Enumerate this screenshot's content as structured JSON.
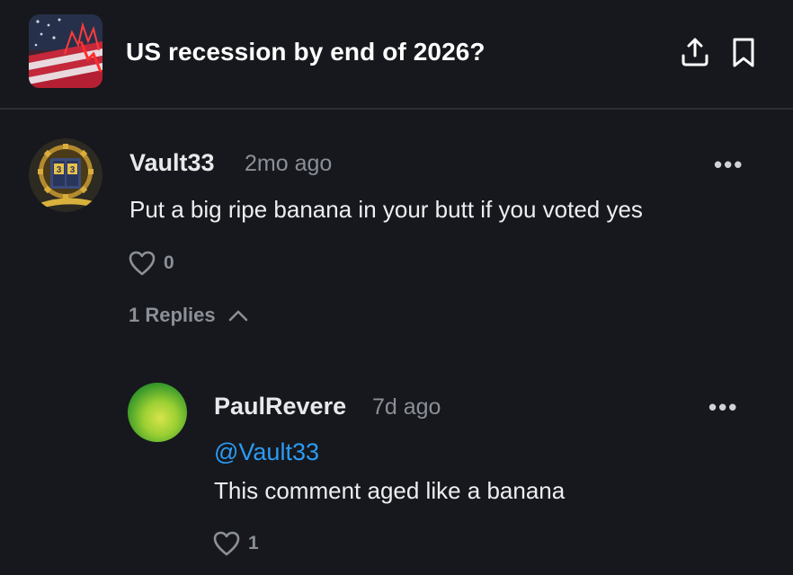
{
  "market": {
    "title": "US recession by end of 2026?"
  },
  "header_icons": {
    "share": "share-icon",
    "bookmark": "bookmark-icon"
  },
  "comment": {
    "username": "Vault33",
    "timestamp": "2mo ago",
    "text": "Put a big ripe banana in your butt if you voted yes",
    "likes": "0",
    "more": "•••"
  },
  "replies_toggle": {
    "label": "1 Replies"
  },
  "reply": {
    "username": "PaulRevere",
    "timestamp": "7d ago",
    "mention": "@Vault33",
    "text": "This comment aged like a banana",
    "likes": "1",
    "more": "•••"
  },
  "colors": {
    "background": "#16181d",
    "mention": "#2b9bf4",
    "muted": "#8b8f97"
  }
}
